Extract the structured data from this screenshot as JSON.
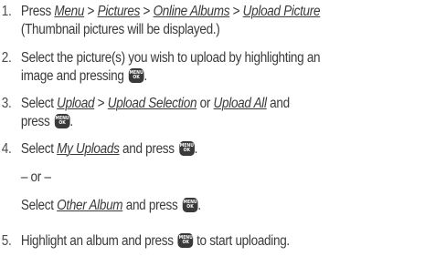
{
  "key_label": {
    "top": "MENU",
    "bottom": "OK"
  },
  "steps": [
    {
      "number": "1.",
      "text_a": "Press ",
      "link_menu": "Menu",
      "sep1": " > ",
      "link_pictures": "Pictures",
      "sep2": " > ",
      "link_online": "Online Albums",
      "sep3": " > ",
      "link_upload": "Upload Picture",
      "line2": "(Thumbnail pictures will be displayed.)"
    },
    {
      "number": "2.",
      "line1": "Select the picture(s) you wish to upload by highlighting an",
      "line2_a": "image and pressing ",
      "line2_b": "."
    },
    {
      "number": "3.",
      "text_a": "Select ",
      "link_upload": "Upload",
      "sep1": " > ",
      "link_selection": "Upload Selection",
      "text_b": " or ",
      "link_all": "Upload All",
      "text_c": " and",
      "line2_a": "press ",
      "line2_b": "."
    },
    {
      "number": "4.",
      "text_a": "Select ",
      "link_myuploads": "My Uploads",
      "text_b": " and press ",
      "text_c": "."
    },
    {
      "or": "– or –",
      "text_a": "Select ",
      "link_other": "Other Album",
      "text_b": " and press ",
      "text_c": "."
    },
    {
      "number": "5.",
      "text_a": "Highlight an album and press ",
      "text_b": " to start uploading."
    }
  ]
}
